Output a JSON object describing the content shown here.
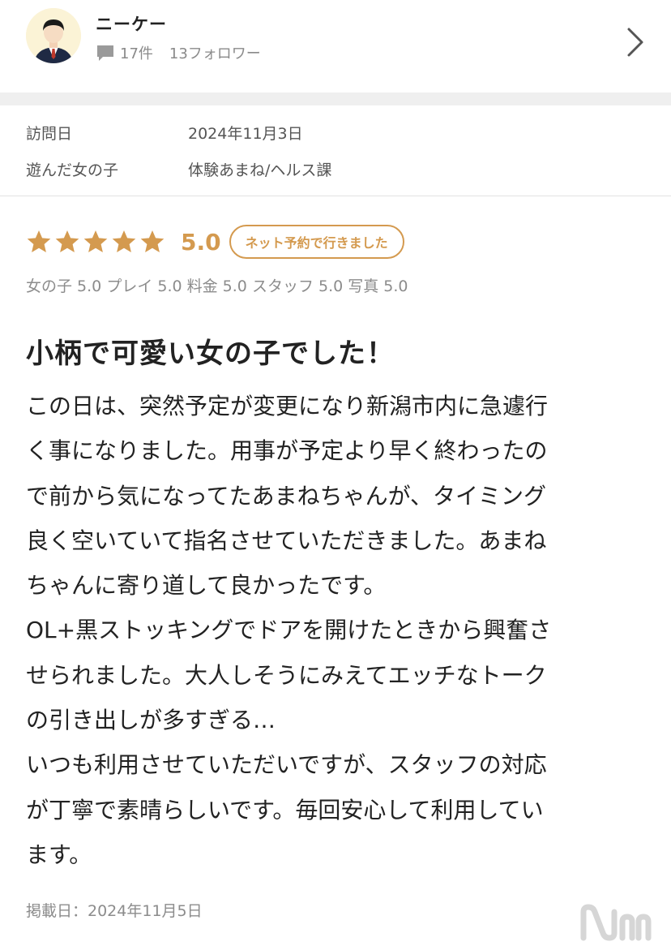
{
  "reviewer": {
    "name": "ニーケー",
    "review_count": "17件",
    "followers": "13フォロワー"
  },
  "visit": {
    "date_label": "訪問日",
    "date_value": "2024年11月3日",
    "girl_label": "遊んだ女の子",
    "girl_value": "体験あまね/ヘルス課"
  },
  "rating": {
    "stars": 5,
    "score": "5.0",
    "badge": "ネット予約で行きました",
    "sub_scores": [
      "女の子 5.0",
      "プレイ 5.0",
      "料金 5.0",
      "スタッフ 5.0",
      "写真 5.0"
    ]
  },
  "review": {
    "title": "小柄で可愛い女の子でした！",
    "lines": [
      "この日は、突然予定が変更になり新潟市内に急遽行",
      "く事になりました。用事が予定より早く終わったの",
      "で前から気になってたあまねちゃんが、タイミング",
      "良く空いていて指名させていただきました。あまね",
      "ちゃんに寄り道して良かったです。",
      "OL+黒ストッキングでドアを開けたときから興奮さ",
      "せられました。大人しそうにみえてエッチなトーク",
      "の引き出しが多すぎる…",
      "いつも利用させていただいですが、スタッフの対応",
      "が丁寧で素晴らしいです。毎回安心して利用してい",
      "ます。"
    ],
    "posted": "掲載日：2024年11月5日"
  },
  "colors": {
    "accent": "#d49a4f",
    "band": "#efefef",
    "muted_text": "#8c8c8c"
  },
  "icons": [
    "avatar-icon",
    "comment-icon",
    "chevron-right-icon",
    "star-icon",
    "watermark-logo"
  ]
}
